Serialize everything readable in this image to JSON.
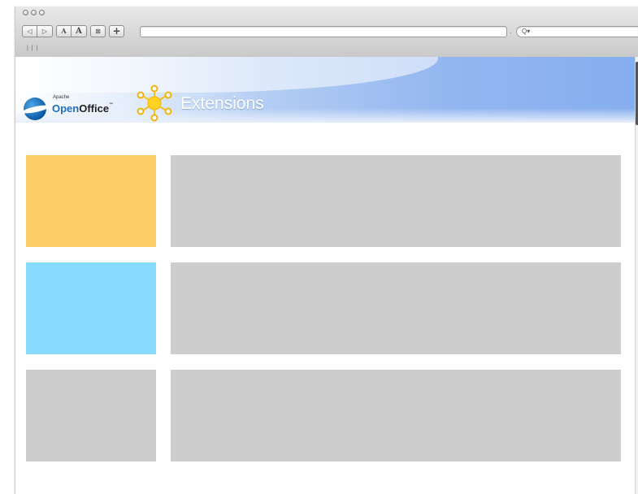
{
  "browser": {
    "url_value": "",
    "search_placeholder": "",
    "search_icon": "Q▾",
    "toolbar": {
      "back_icon": "◁",
      "forward_icon": "▷",
      "font_small": "A",
      "font_large": "A",
      "bookmark_icon": "⊠",
      "add_icon": "+"
    },
    "tab_mark": "| | |"
  },
  "header": {
    "logo_small": "Apache",
    "logo_open": "Open",
    "logo_office": "Office",
    "logo_tm": "™",
    "section_title": "Extensions"
  },
  "colors": {
    "thumb_1": "#fece66",
    "thumb_2": "#88dbfd",
    "thumb_3": "#cdcdcd",
    "placeholder": "#cdcdcd",
    "banner_accent": "#86aeee"
  },
  "extension_rows": [
    {
      "thumbnail": "yellow-thumbnail",
      "details": ""
    },
    {
      "thumbnail": "blue-thumbnail",
      "details": ""
    },
    {
      "thumbnail": "gray-thumbnail",
      "details": ""
    }
  ]
}
